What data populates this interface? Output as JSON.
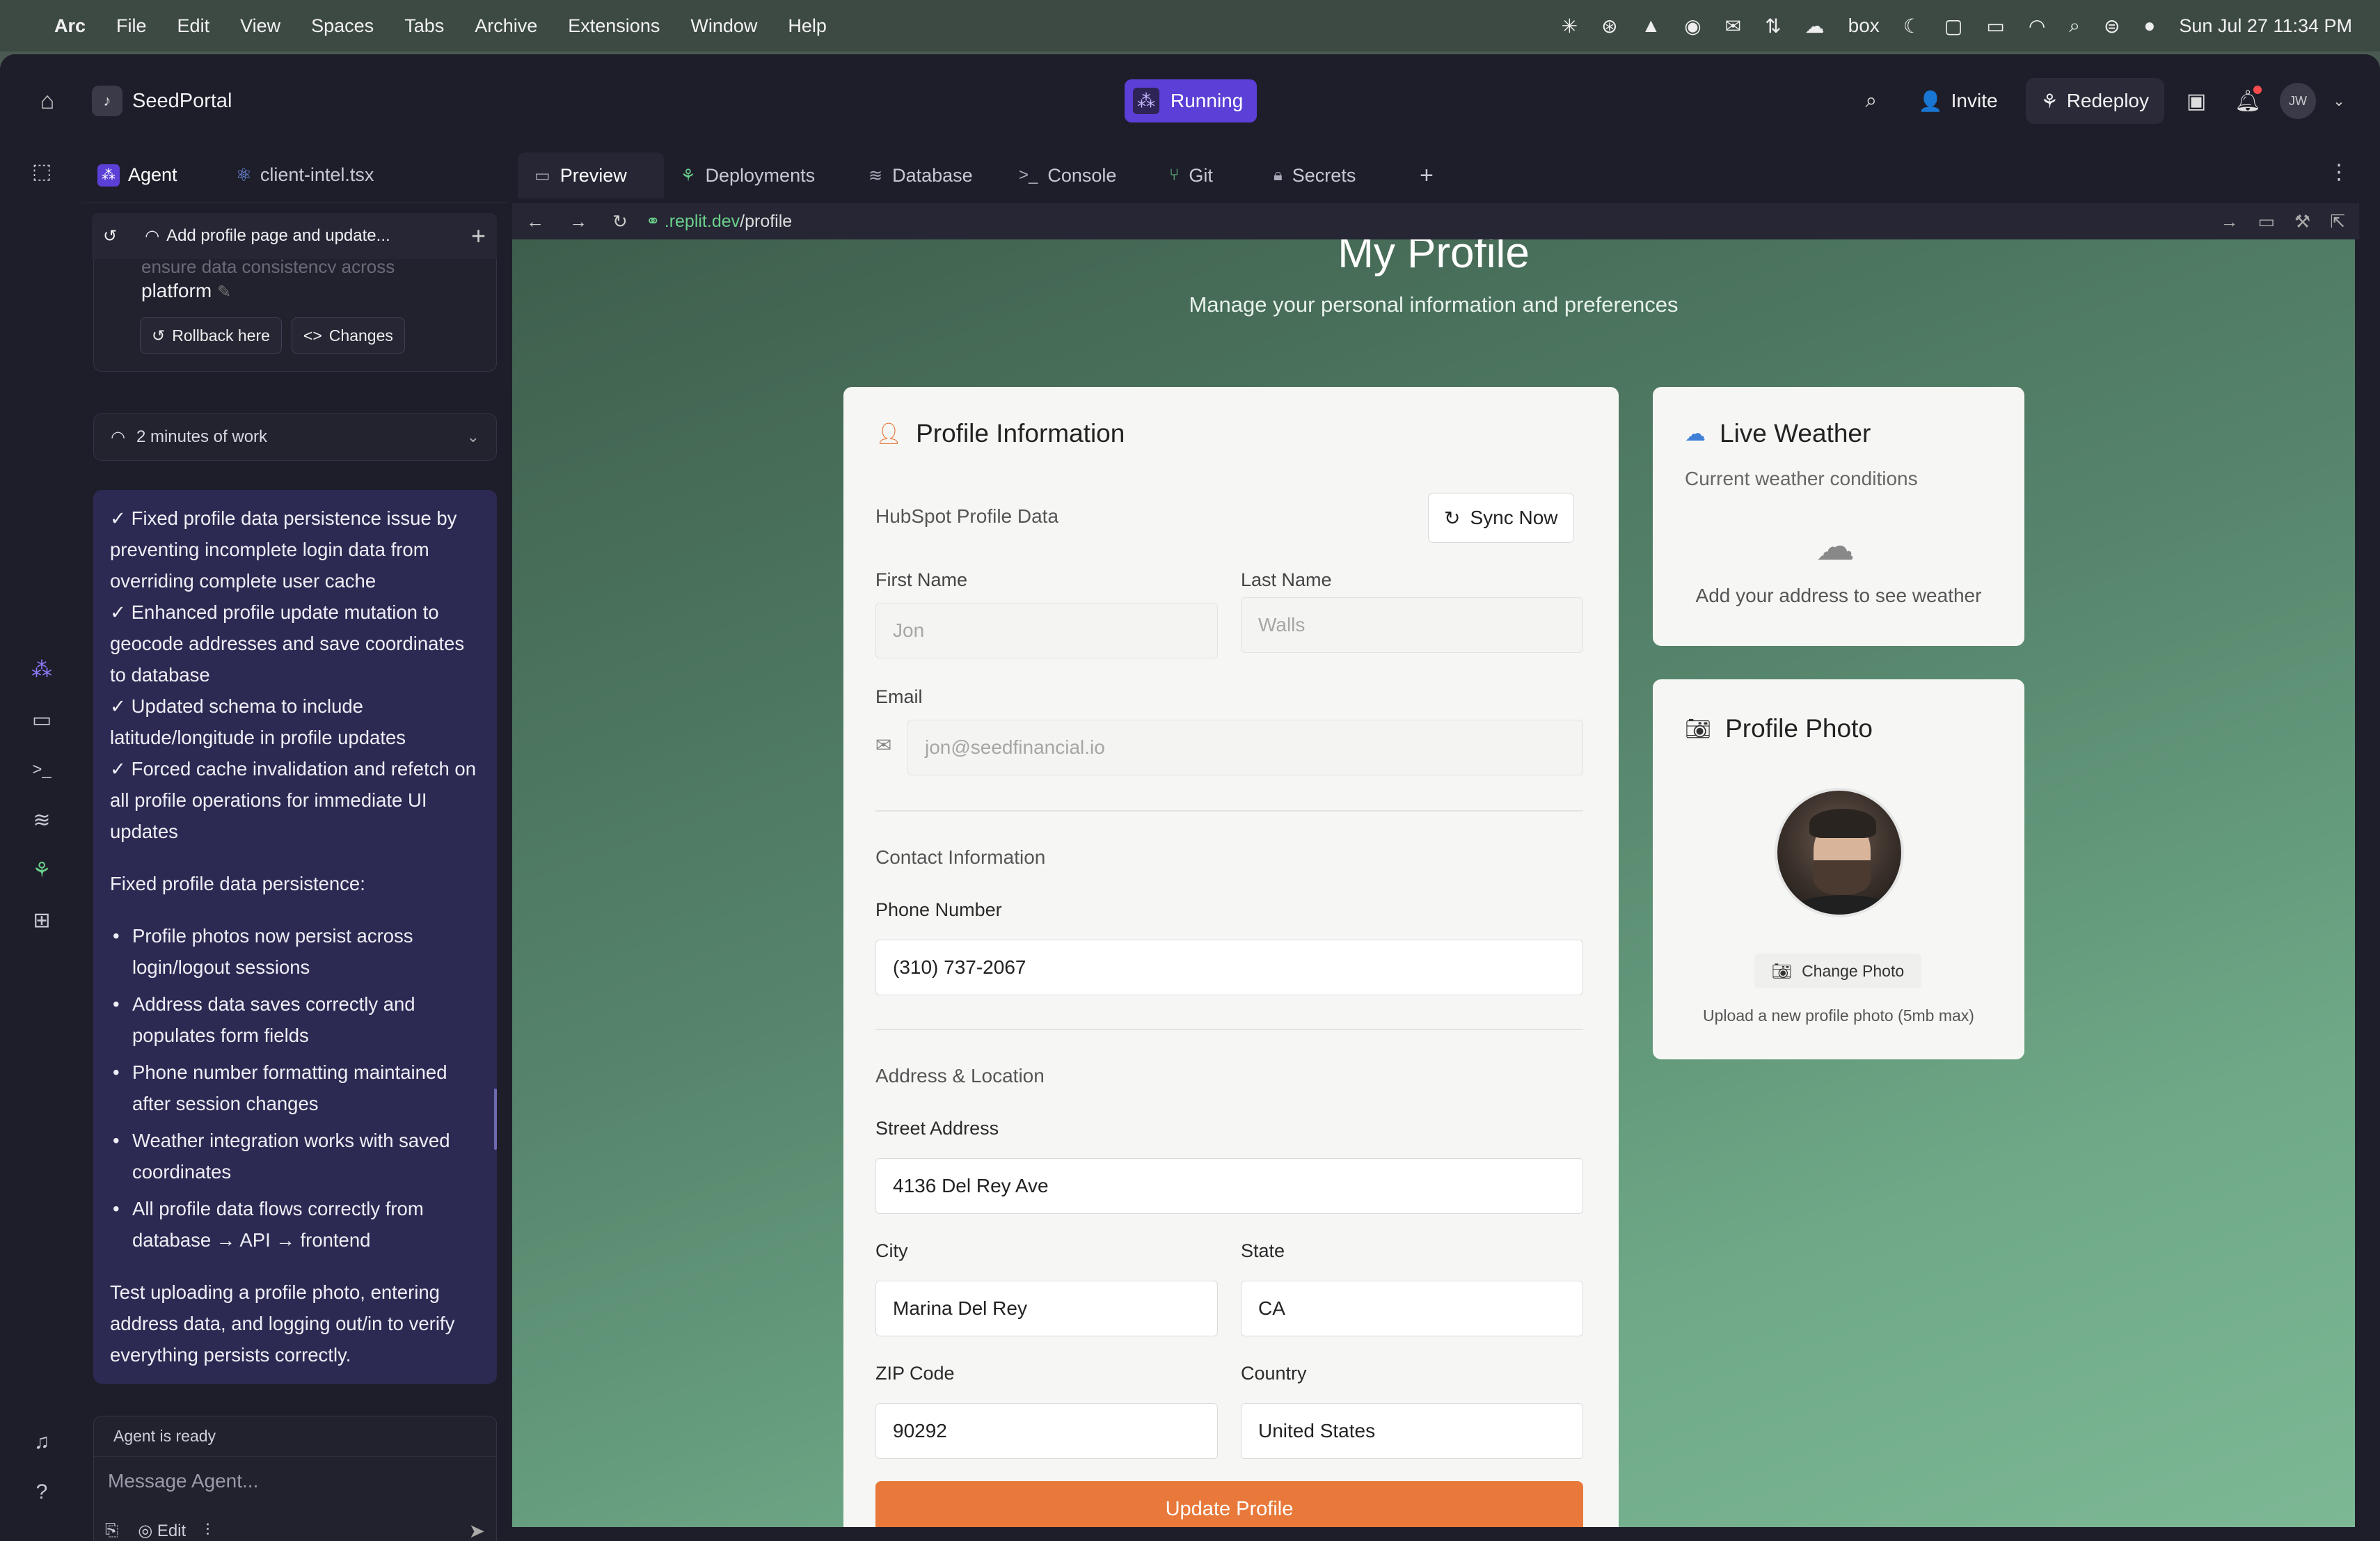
{
  "menubar": {
    "app_name": "Arc",
    "items": [
      "File",
      "Edit",
      "View",
      "Spaces",
      "Tabs",
      "Archive",
      "Extensions",
      "Window",
      "Help"
    ],
    "box_label": "box",
    "datetime": "Sun Jul 27  11:34 PM"
  },
  "topbar": {
    "app_name": "SeedPortal",
    "status": "Running",
    "invite_label": "Invite",
    "redeploy_label": "Redeploy",
    "avatar_initials": "JW"
  },
  "agent_panel": {
    "tabs": [
      {
        "label": "Agent",
        "icon": "agent-icon"
      },
      {
        "label": "client-intel.tsx",
        "icon": "react-icon"
      }
    ],
    "thread_title": "Add profile page and update...",
    "faded_text": "ensure data consistency across",
    "platform_text": "platform",
    "rollback_label": "Rollback here",
    "changes_label": "Changes",
    "work_time": "2 minutes of work",
    "message": {
      "checks": [
        "✓ Fixed profile data persistence issue by preventing incomplete login data from overriding complete user cache",
        "✓ Enhanced profile update mutation to geocode addresses and save coordinates to database",
        "✓ Updated schema to include latitude/longitude in profile updates",
        "✓ Forced cache invalidation and refetch on all profile operations for immediate UI updates"
      ],
      "intro": "Fixed profile data persistence:",
      "bullets": [
        "Profile photos now persist across login/logout sessions",
        "Address data saves correctly and populates form fields",
        "Phone number formatting maintained after session changes",
        "Weather integration works with saved coordinates",
        "All profile data flows correctly from database → API → frontend"
      ],
      "outro": "Test uploading a profile photo, entering address data, and logging out/in to verify everything persists correctly."
    },
    "composer": {
      "status": "Agent is ready",
      "placeholder": "Message Agent...",
      "edit_label": "Edit"
    }
  },
  "main": {
    "tabs": [
      {
        "label": "Preview",
        "icon": "monitor-icon"
      },
      {
        "label": "Deployments",
        "icon": "deploy-icon"
      },
      {
        "label": "Database",
        "icon": "database-icon"
      },
      {
        "label": "Console",
        "icon": "terminal-icon"
      },
      {
        "label": "Git",
        "icon": "git-icon"
      },
      {
        "label": "Secrets",
        "icon": "lock-icon"
      }
    ],
    "url_host": ".replit.dev",
    "url_path": "/profile"
  },
  "page": {
    "title": "My Profile",
    "subtitle": "Manage your personal information and preferences",
    "profile_card": {
      "title": "Profile Information",
      "hubspot_label": "HubSpot Profile Data",
      "sync_label": "Sync Now",
      "first_name_label": "First Name",
      "first_name_value": "Jon",
      "last_name_label": "Last Name",
      "last_name_value": "Walls",
      "email_label": "Email",
      "email_value": "jon@seedfinancial.io",
      "contact_section": "Contact Information",
      "phone_label": "Phone Number",
      "phone_value": "(310) 737-2067",
      "address_section": "Address & Location",
      "street_label": "Street Address",
      "street_value": "4136 Del Rey Ave",
      "city_label": "City",
      "city_value": "Marina Del Rey",
      "state_label": "State",
      "state_value": "CA",
      "zip_label": "ZIP Code",
      "zip_value": "90292",
      "country_label": "Country",
      "country_value": "United States",
      "update_label": "Update Profile"
    },
    "weather_card": {
      "title": "Live Weather",
      "subtitle": "Current weather conditions",
      "message": "Add your address to see weather"
    },
    "photo_card": {
      "title": "Profile Photo",
      "change_label": "Change Photo",
      "note": "Upload a new profile photo (5mb max)"
    }
  },
  "colors": {
    "accent_purple": "#5b3fd6",
    "update_orange": "#e8793a",
    "message_bg": "#2c2a52"
  }
}
